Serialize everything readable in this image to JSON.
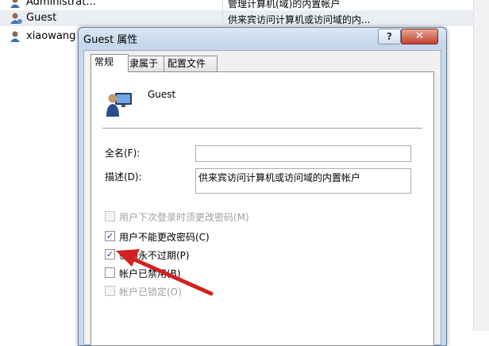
{
  "user_list": {
    "rows": [
      {
        "name": "Administrat...",
        "description": "管理计算机(域)的内置帐户"
      },
      {
        "name": "Guest",
        "description": "供来宾访问计算机或访问域的内..."
      },
      {
        "name": "xiaowang",
        "description": ""
      }
    ]
  },
  "dialog": {
    "title": "Guest 属性",
    "help_label": "?",
    "close_label": "✕",
    "tabs": [
      {
        "label": "常规"
      },
      {
        "label": "隶属于"
      },
      {
        "label": "配置文件"
      }
    ],
    "active_tab": "常规",
    "user_name": "Guest",
    "full_name_label": "全名(F):",
    "full_name_value": "",
    "description_label": "描述(D):",
    "description_value": "供来宾访问计算机或访问域的内置帐户",
    "checkboxes": [
      {
        "label": "用户下次登录时须更改密码(M)",
        "checked": false,
        "enabled": false
      },
      {
        "label": "用户不能更改密码(C)",
        "checked": true,
        "enabled": true
      },
      {
        "label": "密码永不过期(P)",
        "checked": true,
        "enabled": true
      },
      {
        "label": "帐户已禁用(B)",
        "checked": false,
        "enabled": true
      },
      {
        "label": "帐户已锁定(O)",
        "checked": false,
        "enabled": false
      }
    ]
  },
  "colors": {
    "arrow": "#d32020",
    "dialog_frame": "#c9d9ed",
    "close_button": "#c4412f"
  }
}
